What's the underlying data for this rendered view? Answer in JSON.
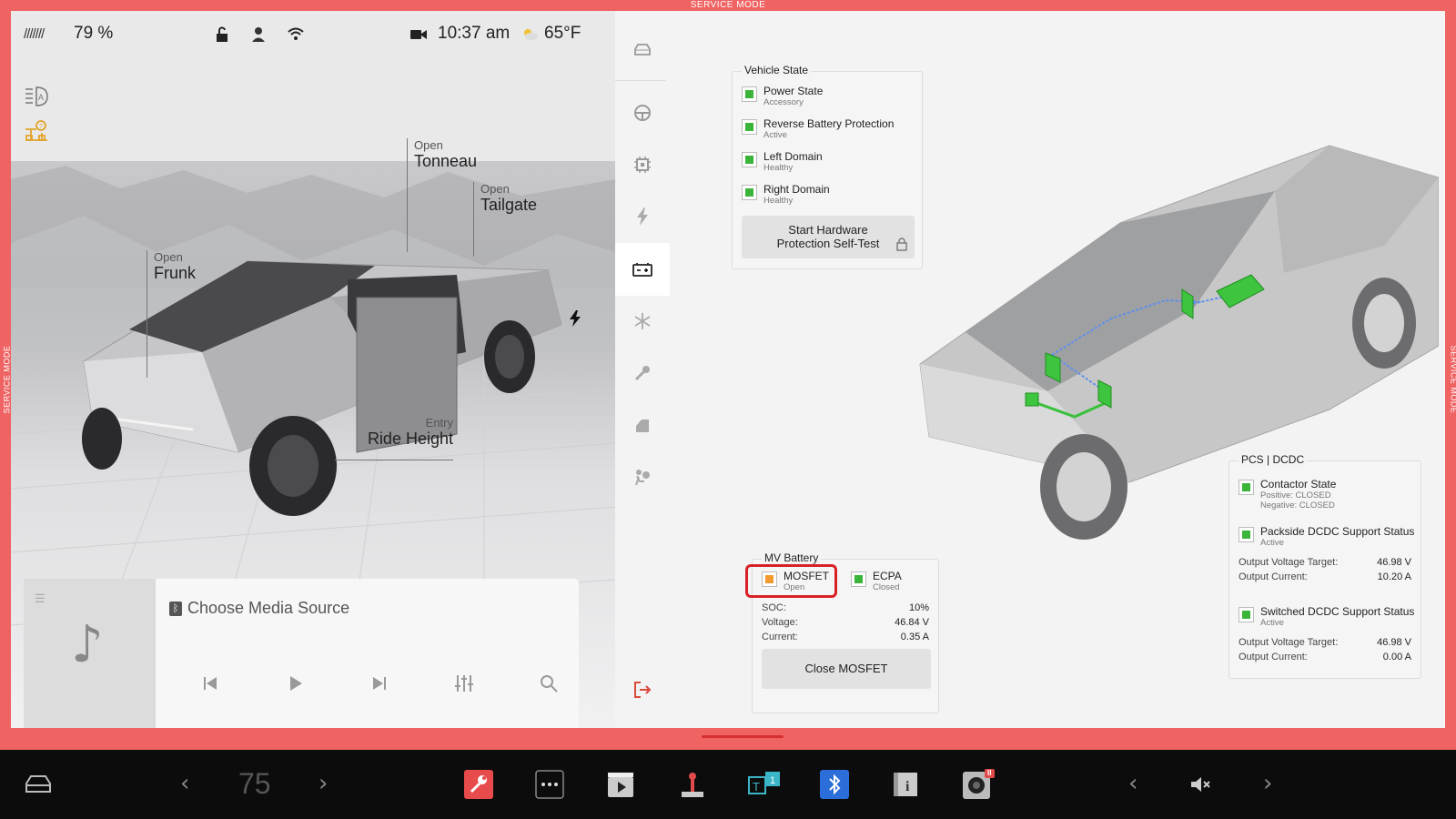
{
  "banner": {
    "service_top": "SERVICE MODE",
    "service_side": "SERVICE MODE"
  },
  "status": {
    "battery_pct": "79 %",
    "time": "10:37 am",
    "temperature": "65°F"
  },
  "car_labels": {
    "tonneau": {
      "state": "Open",
      "name": "Tonneau"
    },
    "tailgate": {
      "state": "Open",
      "name": "Tailgate"
    },
    "frunk": {
      "state": "Open",
      "name": "Frunk"
    },
    "ride_height": {
      "state": "Entry",
      "name": "Ride Height"
    }
  },
  "media": {
    "source_label": "Choose Media Source"
  },
  "vehicle_state": {
    "title": "Vehicle State",
    "items": [
      {
        "label": "Power State",
        "status": "Accessory",
        "color": "#3ab53a"
      },
      {
        "label": "Reverse Battery Protection",
        "status": "Active",
        "color": "#3ab53a"
      },
      {
        "label": "Left Domain",
        "status": "Healthy",
        "color": "#3ab53a"
      },
      {
        "label": "Right Domain",
        "status": "Healthy",
        "color": "#3ab53a"
      }
    ],
    "self_test_button": {
      "line1": "Start Hardware",
      "line2": "Protection Self-Test"
    }
  },
  "mv_battery": {
    "title": "MV Battery",
    "mosfet": {
      "label": "MOSFET",
      "status": "Open",
      "color": "#f39a2e"
    },
    "ecpa": {
      "label": "ECPA",
      "status": "Closed",
      "color": "#3ab53a"
    },
    "soc": {
      "label": "SOC:",
      "value": "10%"
    },
    "voltage": {
      "label": "Voltage:",
      "value": "46.84 V"
    },
    "current": {
      "label": "Current:",
      "value": "0.35 A"
    },
    "close_button": "Close MOSFET"
  },
  "pcs_dcdc": {
    "title": "PCS | DCDC",
    "contactor": {
      "label": "Contactor State",
      "positive": "Positive:  CLOSED",
      "negative": "Negative: CLOSED"
    },
    "packside": {
      "label": "Packside DCDC Support Status",
      "status": "Active",
      "voltage_target": {
        "label": "Output Voltage Target:",
        "value": "46.98 V"
      },
      "current": {
        "label": "Output Current:",
        "value": "10.20 A"
      }
    },
    "switched": {
      "label": "Switched DCDC Support Status",
      "status": "Active",
      "voltage_target": {
        "label": "Output Voltage Target:",
        "value": "46.98 V"
      },
      "current": {
        "label": "Output Current:",
        "value": "0.00 A"
      }
    }
  },
  "dock": {
    "speed": "75",
    "camera_badge": "II"
  },
  "colors": {
    "service_frame": "#ef6363",
    "ok": "#3ab53a",
    "warn": "#f39a2e",
    "highlight": "#d82127",
    "active_accent": "#d84a3b"
  }
}
